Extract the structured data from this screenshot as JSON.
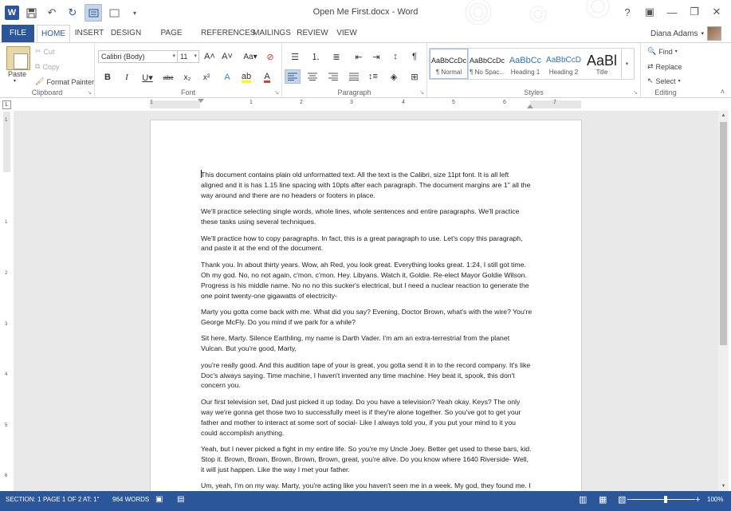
{
  "window": {
    "title": "Open Me First.docx - Word",
    "help": "?",
    "controls": [
      "▣",
      "—",
      "❐",
      "✕"
    ]
  },
  "qat": {
    "logo": "W",
    "save_icon": "💾",
    "undo_icon": "↶",
    "redo_icon": "↻",
    "customize_icon": "▾"
  },
  "tabs": [
    "FILE",
    "HOME",
    "INSERT",
    "DESIGN",
    "PAGE LAYOUT",
    "REFERENCES",
    "MAILINGS",
    "REVIEW",
    "VIEW"
  ],
  "user": {
    "name": "Diana Adams",
    "dropdown": "▾"
  },
  "clipboard": {
    "paste": "Paste",
    "cut": "Cut",
    "copy": "Copy",
    "format_painter": "Format Painter",
    "label": "Clipboard"
  },
  "font": {
    "name": "Calibri (Body)",
    "size": "11",
    "grow": "A˄",
    "shrink": "A˅",
    "case": "Aa▾",
    "clear": "A̸",
    "bold": "B",
    "italic": "I",
    "underline": "U▾",
    "strike": "abc",
    "subscript": "x₂",
    "superscript": "x²",
    "label": "Font"
  },
  "paragraph": {
    "label": "Paragraph",
    "pilcrow": "¶"
  },
  "styles": {
    "items": [
      {
        "sample": "AaBbCcDc",
        "name": "¶ Normal"
      },
      {
        "sample": "AaBbCcDc",
        "name": "¶ No Spac..."
      },
      {
        "sample": "AaBbCc",
        "name": "Heading 1"
      },
      {
        "sample": "AaBbCcD",
        "name": "Heading 2"
      },
      {
        "sample": "AaBl",
        "name": "Title"
      }
    ],
    "label": "Styles"
  },
  "editing": {
    "find": "Find",
    "replace": "Replace",
    "select": "Select",
    "label": "Editing"
  },
  "ruler": {
    "corner": "L",
    "h_numbers": [
      "1",
      "1",
      "2",
      "3",
      "4",
      "5",
      "6",
      "7"
    ],
    "v_numbers": [
      "1",
      "1",
      "2",
      "3",
      "4",
      "5",
      "6"
    ]
  },
  "document": {
    "paragraphs": [
      "This document contains plain old unformatted text. All the text is the Calibri, size 11pt font. It is all left aligned and it is has 1.15 line spacing with 10pts after each paragraph. The document margins are 1\" all the way around and there are no headers or footers in place.",
      "We'll practice selecting single words, whole lines, whole sentences and entire paragraphs. We'll practice these tasks using several techniques.",
      "We'll practice how to copy paragraphs. In fact, this is a great paragraph to use. Let's copy this paragraph, and paste it at the end of the document.",
      "Thank you. In about thirty years. Wow, ah Red, you look great. Everything looks great. 1:24, I still got time. Oh my god. No, no not again, c'mon, c'mon. Hey. Libyans. Watch it, Goldie. Re-elect Mayor Goldie Wilson. Progress is his middle name. No no no this sucker's electrical, but I need a nuclear reaction to generate the one point twenty-one gigawatts of electricity-",
      "Marty you gotta come back with me. What did you say? Evening, Doctor Brown, what's with the wire? You're George McFly. Do you mind if we park for a while?",
      "Sit here, Marty. Silence Earthling, my name is Darth Vader. I'm am an extra-terrestrial from the planet Vulcan. But you're good, Marty,",
      "you're really good. And this audition tape of your is great, you gotta send it in to the record company. It's like Doc's always saying. Time machine, I haven't invented any time machine. Hey beat it, spook, this don't concern you.",
      "Our first television set, Dad just picked it up today. Do you have a television? Yeah okay. Keys? The only way we're gonna get those two to successfully meet is if they're alone together. So you've got to get your father and mother to interact at some sort of social- Like I always told you, if you put your mind to it you could accomplish anything.",
      "Yeah, but I never picked a fight in my entire life. So you're my Uncle Joey. Better get used to these bars, kid. Stop it. Brown, Brown, Brown, Brown, Brown, great, you're alive. Do you know where 1640 Riverside- Well, it will just happen. Like the way I met your father.",
      "Um, yeah, I'm on my way. Marty, you're acting like you haven't seen me in a week. My god, they found me. I don't know how but they found me. Run for it, Marty. My god, they found me. I don't know how"
    ]
  },
  "status": {
    "section": "SECTION: 1",
    "page": "PAGE 1 OF 2",
    "at": "AT: 1\"",
    "words": "964 WORDS",
    "zoom": "100%",
    "minus": "−",
    "plus": "+"
  },
  "colors": {
    "accent": "#2b579a",
    "highlight": "#ffff00",
    "font_color": "#e03c31"
  }
}
